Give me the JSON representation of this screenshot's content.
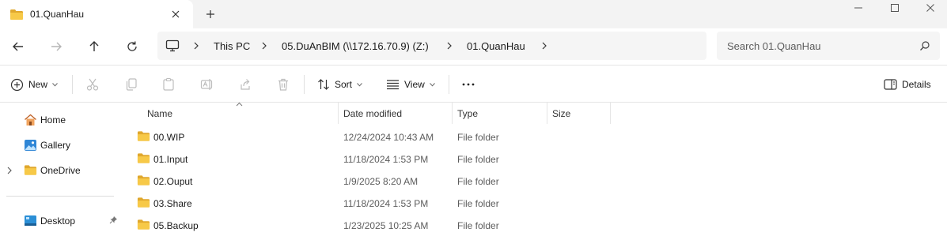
{
  "tab": {
    "title": "01.QuanHau"
  },
  "breadcrumb": [
    "This PC",
    "05.DuAnBIM (\\\\172.16.70.9) (Z:)",
    "01.QuanHau"
  ],
  "search": {
    "placeholder": "Search 01.QuanHau"
  },
  "toolbar": {
    "new_label": "New",
    "sort_label": "Sort",
    "view_label": "View",
    "details_label": "Details"
  },
  "sidebar": {
    "items": [
      {
        "label": "Home",
        "icon": "home-icon"
      },
      {
        "label": "Gallery",
        "icon": "gallery-icon"
      },
      {
        "label": "OneDrive",
        "icon": "folder-icon"
      },
      {
        "label": "Desktop",
        "icon": "desktop-icon"
      }
    ]
  },
  "columns": [
    "Name",
    "Date modified",
    "Type",
    "Size"
  ],
  "files": [
    {
      "name": "00.WIP",
      "date": "12/24/2024 10:43 AM",
      "type": "File folder",
      "size": ""
    },
    {
      "name": "01.Input",
      "date": "11/18/2024 1:53 PM",
      "type": "File folder",
      "size": ""
    },
    {
      "name": "02.Ouput",
      "date": "1/9/2025 8:20 AM",
      "type": "File folder",
      "size": ""
    },
    {
      "name": "03.Share",
      "date": "11/18/2024 1:53 PM",
      "type": "File folder",
      "size": ""
    },
    {
      "name": "05.Backup",
      "date": "1/23/2025 10:25 AM",
      "type": "File folder",
      "size": ""
    }
  ],
  "colors": {
    "folder": "#f7c948",
    "folder_dark": "#e0a82e",
    "accent": "#0067c0"
  }
}
